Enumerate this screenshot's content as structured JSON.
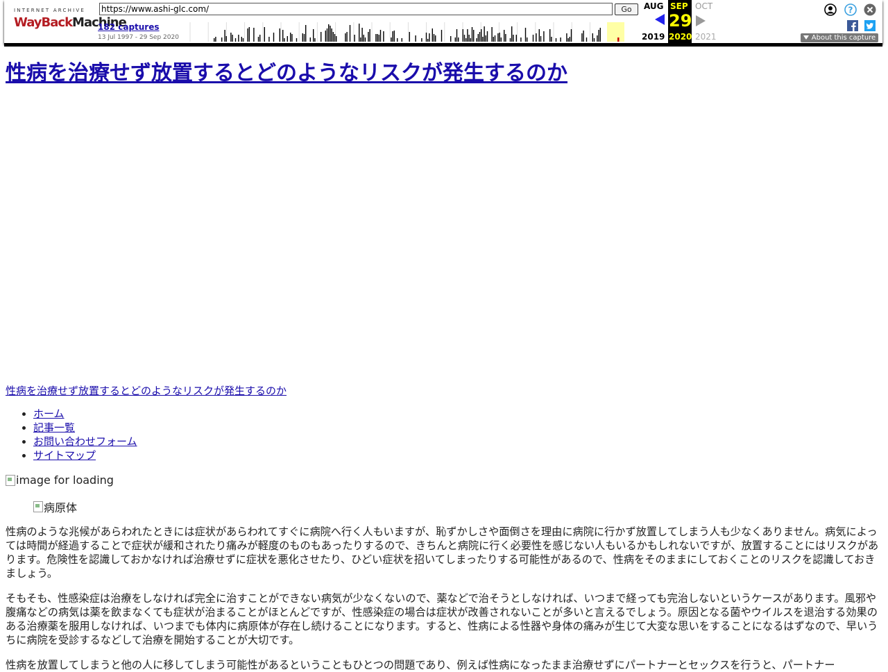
{
  "toolbar": {
    "logo_top": "INTERNET ARCHIVE",
    "logo_wayback": "WayBack",
    "logo_machine": "Machine",
    "url": "https://www.ashi-glc.com/",
    "go_label": "Go",
    "captures_label": "182 captures",
    "date_range": "13 Jul 1997 - 29 Sep 2020",
    "prev_month": "AUG",
    "prev_year": "2019",
    "cur_month": "SEP",
    "cur_day": "29",
    "cur_year": "2020",
    "next_month": "OCT",
    "next_year": "2021",
    "about_label": "About this capture",
    "icons": {
      "user": "user-icon",
      "help": "help-icon",
      "close": "close-icon",
      "facebook": "facebook-icon",
      "twitter": "twitter-icon"
    },
    "colors": {
      "current_month_bg": "#000000",
      "current_month_fg": "#ffff00",
      "prev_arrow": "#2222ee",
      "logo_red": "#b41d23"
    }
  },
  "page": {
    "title": "性病を治療せず放置するとどのようなリスクが発生するのか",
    "site_link": "性病を治療せず放置するとどのようなリスクが発生するのか",
    "nav": [
      "ホーム",
      "記事一覧",
      "お問い合わせフォーム",
      "サイトマップ"
    ],
    "img_loading_alt": "image for loading",
    "img_pathogen_alt": "病原体",
    "paragraphs": [
      "性病のような兆候があらわれたときには症状があらわれてすぐに病院へ行く人もいますが、恥ずかしさや面倒さを理由に病院に行かず放置してしまう人も少なくありません。病気によっては時間が経過することで症状が緩和されたり痛みが軽度のものもあったりするので、きちんと病院に行く必要性を感じない人もいるかもしれないですが、放置することにはリスクがあります。危険性を認識しておかなければ治療せずに症状を悪化させたり、ひどい症状を招いてしまったりする可能性があるので、性病をそのままにしておくことのリスクを認識しておきましょう。",
      "そもそも、性感染症は治療をしなければ完全に治すことができない病気が少なくないので、薬などで治そうとしなければ、いつまで経っても完治しないというケースがあります。風邪や腹痛などの病気は薬を飲まなくても症状が治まることがほとんどですが、性感染症の場合は症状が改善されないことが多いと言えるでしょう。原因となる菌やウイルスを退治する効果のある治療薬を服用しなければ、いつまでも体内に病原体が存在し続けることになります。すると、性病による性器や身体の痛みが生じて大変な思いをすることになるはずなので、早いうちに病院を受診するなどして治療を開始することが大切です。",
      "性病を放置してしまうと他の人に移してしまう可能性があるということもひとつの問題であり、例えば性病になったまま治療せずにパートナーとセックスを行うと、パートナー"
    ]
  }
}
